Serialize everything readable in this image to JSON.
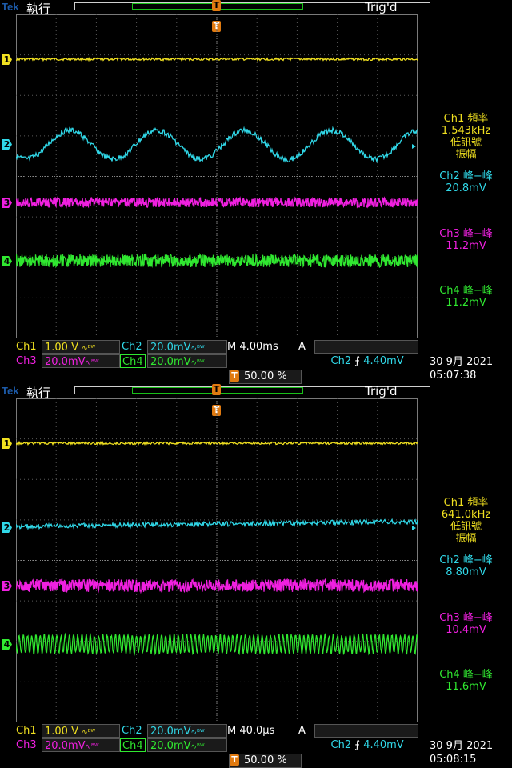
{
  "colors": {
    "ch1": "#f0e020",
    "ch2": "#30d8e8",
    "ch3": "#f020e0",
    "ch4": "#30e830",
    "trigger": "#e07a10",
    "grid": "#5a5a5a",
    "brand": "#1c5aa8"
  },
  "panels": [
    {
      "brand": "Tek",
      "status": "執行",
      "trig_status": "Trig'd",
      "trigger_marker": "T",
      "channel_markers": [
        "1",
        "2",
        "3",
        "4"
      ],
      "measurements": [
        {
          "title": "Ch1 頻率",
          "value": "1.543kHz",
          "note1": "低訊號",
          "note2": "振幅"
        },
        {
          "title": "Ch2 峰−峰",
          "value": "20.8mV"
        },
        {
          "title": "Ch3 峰−峰",
          "value": "11.2mV"
        },
        {
          "title": "Ch4 峰−峰",
          "value": "11.2mV"
        }
      ],
      "ch1": {
        "label": "Ch1",
        "scale": "1.00 V"
      },
      "ch2": {
        "label": "Ch2",
        "scale": "20.0mV"
      },
      "ch3": {
        "label": "Ch3",
        "scale": "20.0mV"
      },
      "ch4": {
        "label": "Ch4",
        "scale": "20.0mV"
      },
      "timebase": "M 4.00ms",
      "trigger_info": {
        "mode": "A",
        "source": "Ch2",
        "level": "4.40mV"
      },
      "trigger_position": "50.00 %",
      "date": "30 9月  2021",
      "time": "05:07:38",
      "waveform": {
        "ch2_shape": "sine",
        "cycles": 4.6,
        "ch4_shape": "noise"
      }
    },
    {
      "brand": "Tek",
      "status": "執行",
      "trig_status": "Trig'd",
      "trigger_marker": "T",
      "channel_markers": [
        "1",
        "2",
        "3",
        "4"
      ],
      "measurements": [
        {
          "title": "Ch1 頻率",
          "value": "641.0kHz",
          "note1": "低訊號",
          "note2": "振幅"
        },
        {
          "title": "Ch2 峰−峰",
          "value": "8.80mV"
        },
        {
          "title": "Ch3 峰−峰",
          "value": "10.4mV"
        },
        {
          "title": "Ch4 峰−峰",
          "value": "11.6mV"
        }
      ],
      "ch1": {
        "label": "Ch1",
        "scale": "1.00 V"
      },
      "ch2": {
        "label": "Ch2",
        "scale": "20.0mV"
      },
      "ch3": {
        "label": "Ch3",
        "scale": "20.0mV"
      },
      "ch4": {
        "label": "Ch4",
        "scale": "20.0mV"
      },
      "timebase": "M 40.0µs",
      "trigger_info": {
        "mode": "A",
        "source": "Ch2",
        "level": "4.40mV"
      },
      "trigger_position": "50.00 %",
      "date": "30 9月  2021",
      "time": "05:08:15",
      "waveform": {
        "ch2_shape": "flat",
        "cycles": 0,
        "ch4_shape": "oscillation"
      }
    }
  ]
}
